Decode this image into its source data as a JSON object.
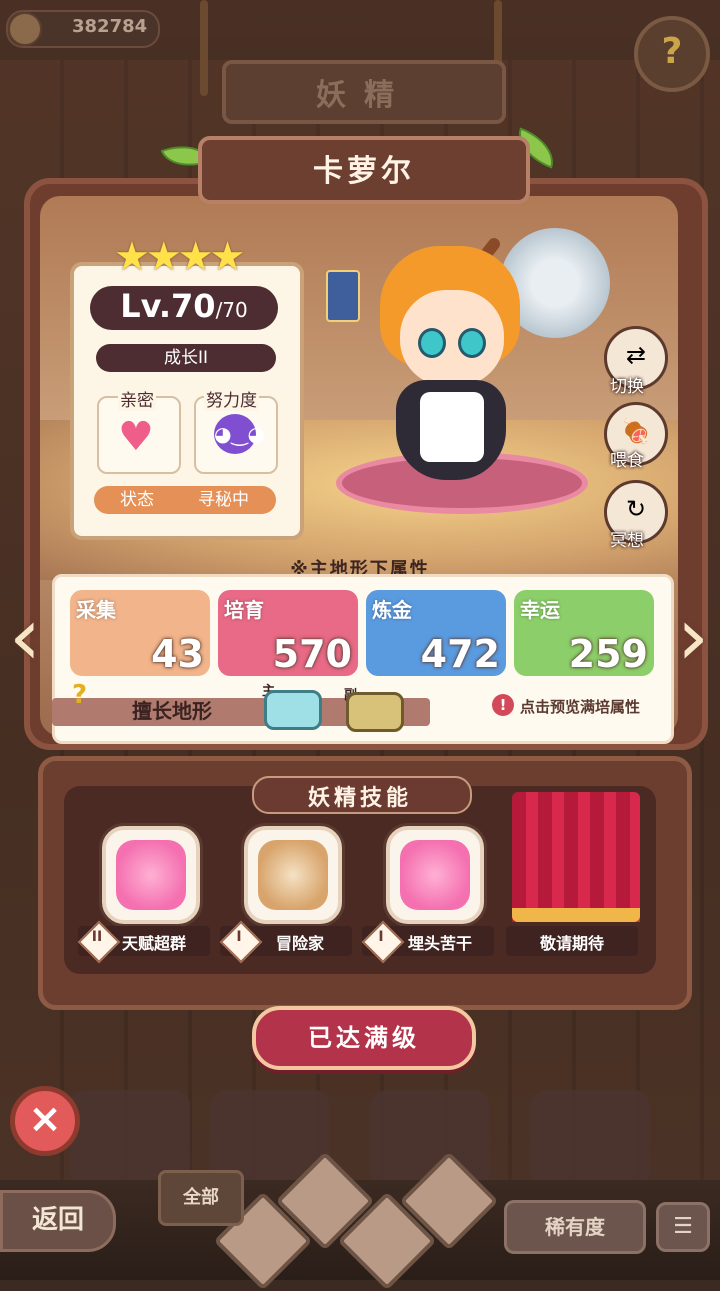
{
  "header": {
    "coins": "382784",
    "title": "妖精",
    "help_icon": "help-sprout-icon"
  },
  "fairy": {
    "name": "卡萝尔",
    "stars": "★★★★",
    "level": "Lv.70",
    "level_max": "/70",
    "growth": "成长II",
    "intimacy_label": "亲密",
    "effort_label": "努力度",
    "state_label": "状态",
    "state_value": "寻秘中"
  },
  "side_actions": [
    {
      "label": "切换",
      "icon": "switch-icon"
    },
    {
      "label": "喂食",
      "icon": "meat-icon"
    },
    {
      "label": "冥想",
      "icon": "meditate-icon"
    }
  ],
  "attributes": {
    "section_title": "※主地形下属性",
    "items": [
      {
        "name": "采集",
        "value": "43",
        "color": "#f2b48a"
      },
      {
        "name": "培育",
        "value": "570",
        "color": "#e86a86"
      },
      {
        "name": "炼金",
        "value": "472",
        "color": "#5a9be0"
      },
      {
        "name": "幸运",
        "value": "259",
        "color": "#8ccf6a"
      }
    ],
    "terrain_label": "擅长地形",
    "main_tag": "主",
    "sub_tag": "副",
    "preview_hint": "点击预览满培属性"
  },
  "skills": {
    "title": "妖精技能",
    "items": [
      {
        "rank": "II",
        "name": "天赋超群"
      },
      {
        "rank": "I",
        "name": "冒险家"
      },
      {
        "rank": "I",
        "name": "埋头苦干"
      },
      {
        "rank": "",
        "name": "敬请期待"
      }
    ]
  },
  "max_button": "已达满级",
  "bottom": {
    "back": "返回",
    "all_tab": "全部",
    "rarity": "稀有度",
    "sort_icon": "sort-icon"
  }
}
